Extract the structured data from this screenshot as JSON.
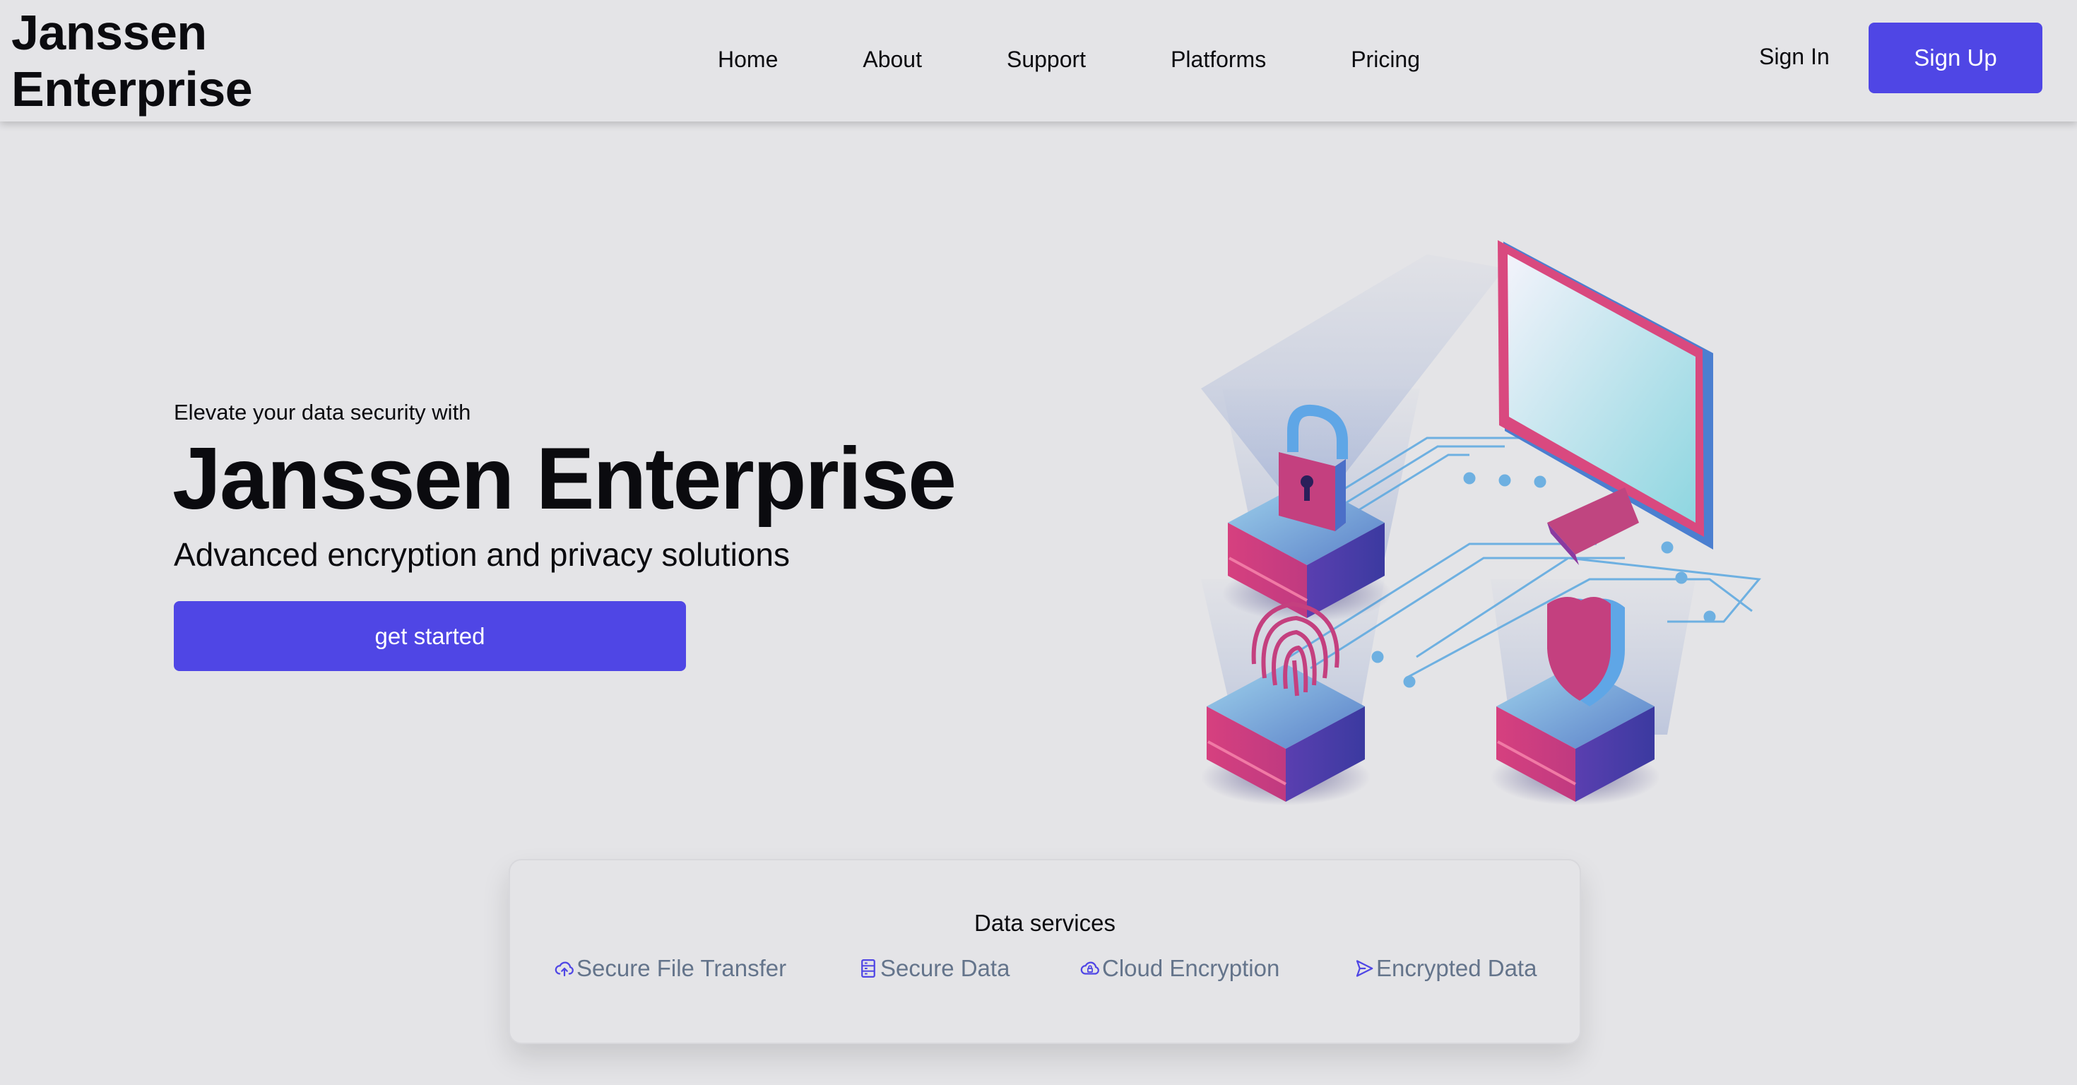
{
  "header": {
    "logo": "Janssen\nEnterprise",
    "nav": [
      "Home",
      "About",
      "Support",
      "Platforms",
      "Pricing"
    ],
    "sign_in": "Sign In",
    "sign_up": "Sign Up"
  },
  "hero": {
    "eyebrow": "Elevate your data security with",
    "title": "Janssen Enterprise",
    "subtitle": "Advanced encryption and privacy solutions",
    "cta": "get started"
  },
  "services": {
    "title": "Data services",
    "items": [
      {
        "label": "Secure File Transfer",
        "icon": "cloud-upload-icon"
      },
      {
        "label": "Secure Data",
        "icon": "server-icon"
      },
      {
        "label": "Cloud Encryption",
        "icon": "cloud-lock-icon"
      },
      {
        "label": "Encrypted Data",
        "icon": "send-icon"
      }
    ]
  },
  "colors": {
    "accent": "#4f46e5",
    "background": "#e4e4e7",
    "muted_text": "#64748b",
    "illustration_pink": "#d6407f",
    "illustration_blue": "#5aa0e0"
  }
}
